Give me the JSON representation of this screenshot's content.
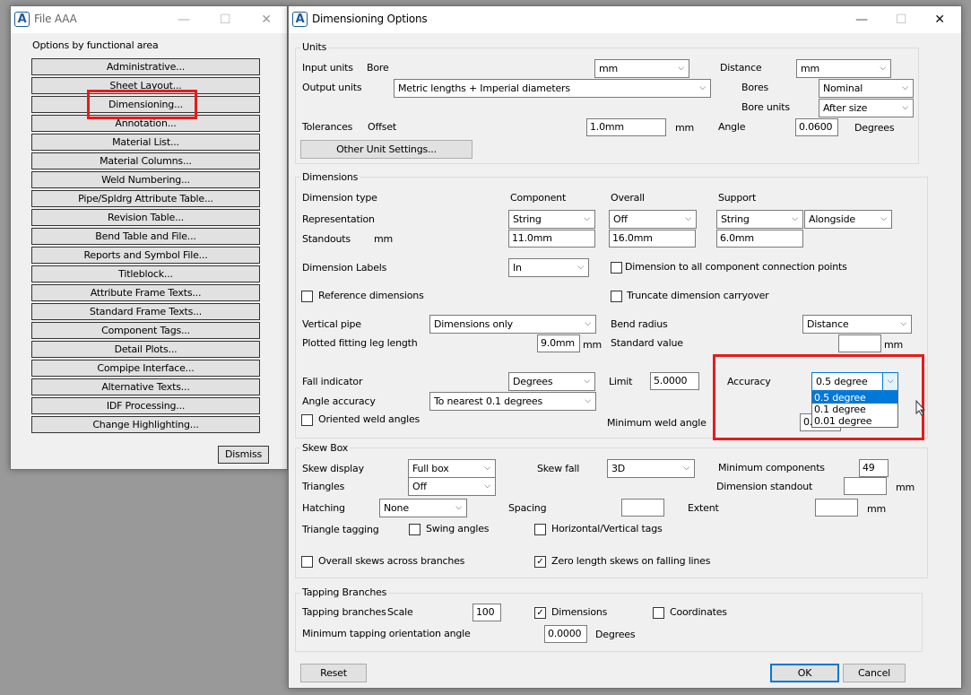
{
  "file_window": {
    "title": "File AAA",
    "subtitle": "Options by functional area",
    "dismiss": "Dismiss",
    "buttons": [
      "Administrative...",
      "Sheet Layout...",
      "Dimensioning...",
      "Annotation...",
      "Material List...",
      "Material Columns...",
      "Weld Numbering...",
      "Pipe/Spldrg Attribute Table...",
      "Revision Table...",
      "Bend Table and File...",
      "Reports and Symbol File...",
      "Titleblock...",
      "Attribute Frame Texts...",
      "Standard Frame Texts...",
      "Component Tags...",
      "Detail Plots...",
      "Compipe Interface...",
      "Alternative Texts...",
      "IDF Processing...",
      "Change Highlighting..."
    ]
  },
  "dlg": {
    "title": "Dimensioning Options",
    "units": {
      "label": "Units",
      "input_units": "Input units",
      "bore": "Bore",
      "bore_val": "mm",
      "distance": "Distance",
      "distance_val": "mm",
      "output_units": "Output units",
      "output_val": "Metric lengths + Imperial diameters",
      "bores": "Bores",
      "bores_val": "Nominal",
      "bore_units": "Bore units",
      "bore_units_val": "After size",
      "tolerances": "Tolerances",
      "offset": "Offset",
      "offset_val": "1.0mm",
      "mm": "mm",
      "angle": "Angle",
      "angle_val": "0.0600",
      "degrees": "Degrees",
      "other_btn": "Other Unit Settings..."
    },
    "dims": {
      "label": "Dimensions",
      "type": "Dimension type",
      "component": "Component",
      "overall": "Overall",
      "support": "Support",
      "representation": "Representation",
      "rep_comp": "String",
      "rep_overall": "Off",
      "rep_support": "String",
      "rep_align": "Alongside",
      "standouts": "Standouts",
      "mm": "mm",
      "so_comp": "11.0mm",
      "so_overall": "16.0mm",
      "so_support": "6.0mm",
      "labels": "Dimension Labels",
      "labels_val": "In",
      "all_conn": "Dimension to all component connection points",
      "ref_dims": "Reference dimensions",
      "truncate": "Truncate dimension carryover",
      "vpipe": "Vertical pipe",
      "vpipe_val": "Dimensions only",
      "bend_radius": "Bend radius",
      "bend_val": "Distance",
      "plotted_leg": "Plotted fitting leg length",
      "leg_val": "9.0mm",
      "std_value": "Standard value",
      "std_val": "",
      "fall_ind": "Fall indicator",
      "fall_val": "Degrees",
      "limit": "Limit",
      "limit_val": "5.0000",
      "accuracy": "Accuracy",
      "accuracy_val": "0.5 degree",
      "acc_opts": [
        "0.5 degree",
        "0.1 degree",
        "0.01 degree"
      ],
      "angle_acc": "Angle accuracy",
      "angle_acc_val": "To nearest 0.1 degrees",
      "oriented": "Oriented weld angles",
      "min_weld": "Minimum weld angle",
      "min_weld_val": "0.",
      "min_weld_tail": "g"
    },
    "skew": {
      "label": "Skew Box",
      "display": "Skew display",
      "display_val": "Full box",
      "fall": "Skew fall",
      "fall_val": "3D",
      "min_comp": "Minimum components",
      "min_comp_val": "49",
      "triangles": "Triangles",
      "triangles_val": "Off",
      "dim_standout": "Dimension standout",
      "mm": "mm",
      "hatching": "Hatching",
      "hatching_val": "None",
      "spacing": "Spacing",
      "extent": "Extent",
      "tri_tag": "Triangle tagging",
      "swing": "Swing angles",
      "hv_tags": "Horizontal/Vertical tags",
      "overall": "Overall skews across branches",
      "zero": "Zero length skews on falling lines",
      "check": "✓"
    },
    "tap": {
      "label": "Tapping Branches",
      "branches": "Tapping branches",
      "scale": "Scale",
      "scale_val": "100",
      "dimensions": "Dimensions",
      "coordinates": "Coordinates",
      "min_angle": "Minimum tapping orientation angle",
      "min_angle_val": "0.0000",
      "degrees": "Degrees"
    },
    "reset": "Reset",
    "ok": "OK",
    "cancel": "Cancel"
  },
  "glyphs": {
    "app": "A",
    "min": "—",
    "max": "☐",
    "close": "✕",
    "arrow": "⌵"
  },
  "colors": {
    "highlight": "#e51c1c",
    "accent": "#0078d7"
  }
}
